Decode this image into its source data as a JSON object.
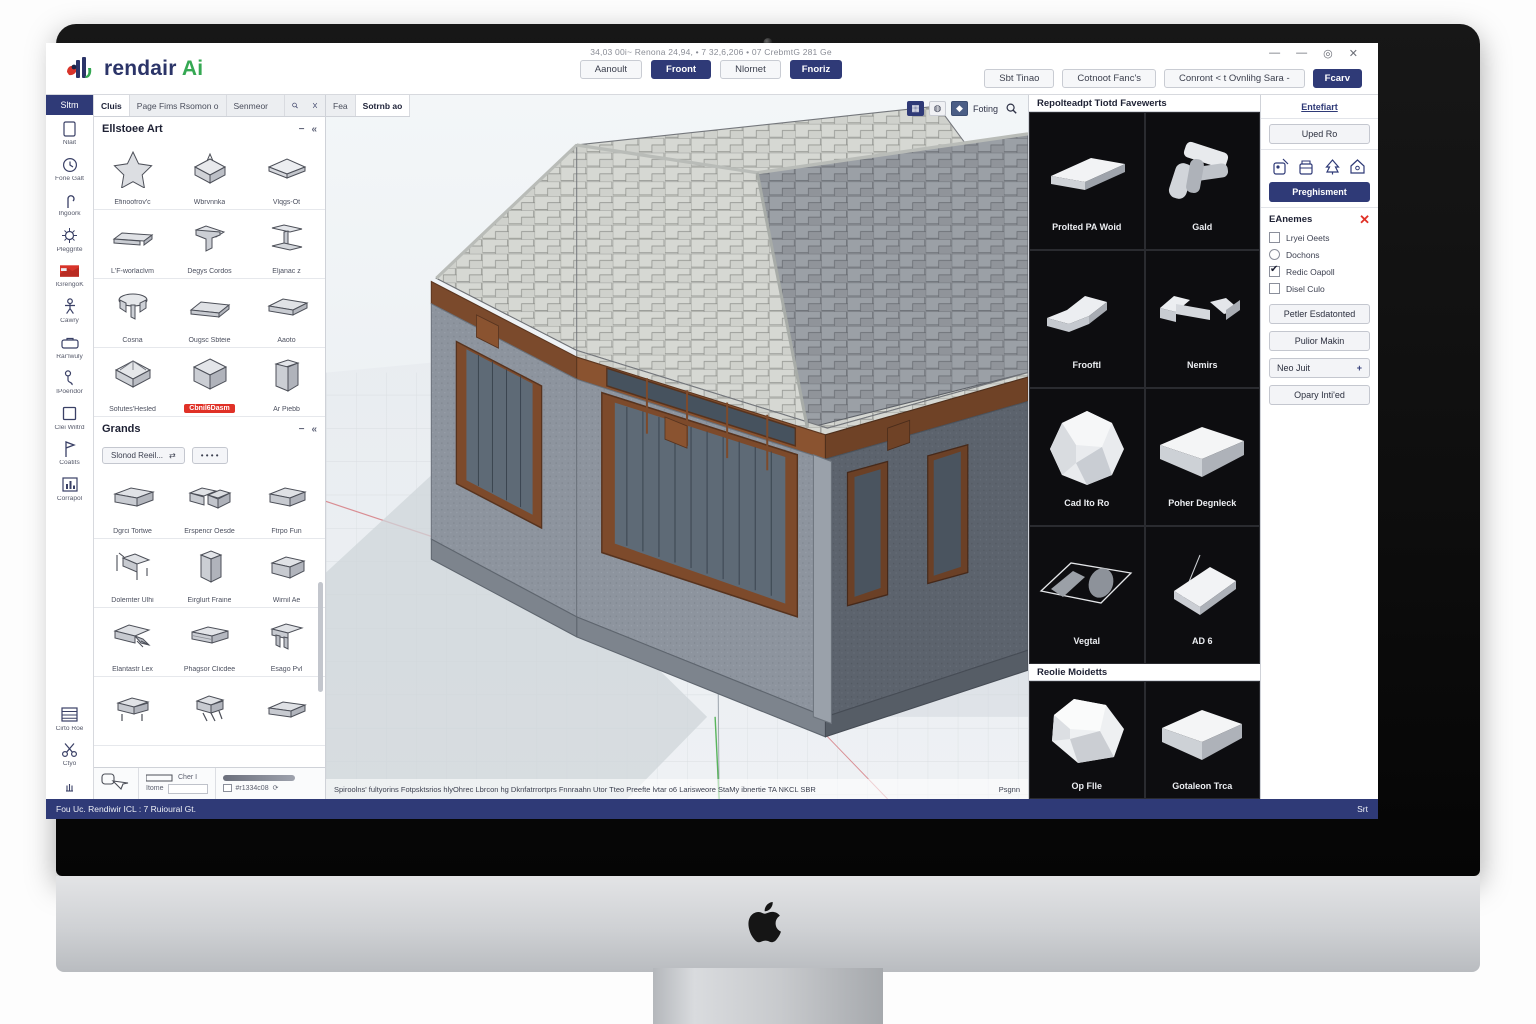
{
  "app": {
    "brand_main": "rendair",
    "brand_suffix": "Ai",
    "title_path": "34,03 00i~  Renona 24,94, • 7 32,6,206  •  07 CrebmtG 281 Ge",
    "status_left": "Fou Uc. Rendiwir ICL : 7 Ruioural Gt.",
    "status_right": "Srt"
  },
  "titlebar": {
    "buttons": [
      {
        "label": "Aanoult",
        "style": "plain"
      },
      {
        "label": "Froont",
        "style": "primary"
      },
      {
        "label": "Nlornet",
        "style": "plain"
      },
      {
        "label": "Fnoriz",
        "style": "primary-sm"
      }
    ],
    "right_buttons": [
      {
        "label": "Sbt Tinao",
        "style": "plain"
      },
      {
        "label": "Cotnoot Fanc's",
        "style": "plain"
      },
      {
        "label": "Conront < t Ovnlihg Sara -",
        "style": "plain"
      },
      {
        "label": "Fcarv",
        "style": "primary"
      }
    ],
    "window_controls": [
      "—",
      "—",
      "◎",
      "✕"
    ]
  },
  "rail": {
    "header": "Sltm",
    "items": [
      {
        "label": "Nlait",
        "icon": "page-icon"
      },
      {
        "label": "Fone Galt",
        "icon": "clock-icon"
      },
      {
        "label": "Ihgoork",
        "icon": "pin-icon"
      },
      {
        "label": "Pleggrite",
        "icon": "node-icon"
      },
      {
        "label": "IGrengoK",
        "icon": "swatch-icon"
      },
      {
        "label": "Cawry",
        "icon": "person-icon"
      },
      {
        "label": "Rar'lwuly",
        "icon": "case-icon"
      },
      {
        "label": "IPoeridor",
        "icon": "figure-icon"
      },
      {
        "label": "Clei Wiltrd",
        "icon": "square-icon"
      },
      {
        "label": "Coatits",
        "icon": "flag-icon"
      },
      {
        "label": "Corrapol",
        "icon": "chart-icon"
      },
      {
        "label": "Cirto Roe",
        "icon": "list-icon"
      },
      {
        "label": "Ctyo",
        "icon": "scissors-icon"
      }
    ],
    "footer_icon": "hand-icon"
  },
  "assets": {
    "tabs": [
      {
        "label": "Cluis",
        "active": true
      },
      {
        "label": "Page Fims Rsomon o",
        "active": false
      },
      {
        "label": "Senmeor",
        "active": false
      }
    ],
    "tab_icons": [
      "search-icon",
      "cut-icon"
    ],
    "vp_tabs": [
      {
        "label": "Fea",
        "active": false
      },
      {
        "label": "Sotrnb ao",
        "active": true
      }
    ],
    "section1": {
      "title": "Ellstoee Art",
      "tools": [
        "−",
        "«"
      ],
      "items": [
        {
          "label": "Efinoofrov'c",
          "shape": "star"
        },
        {
          "label": "Wbrvnnka",
          "shape": "box-peak"
        },
        {
          "label": "Vlqgs-Ot",
          "shape": "slab"
        },
        {
          "label": "L'F-worlaclvm",
          "shape": "beam"
        },
        {
          "label": "Degys Cordos",
          "shape": "bracket"
        },
        {
          "label": "Eljanac z",
          "shape": "i-beam"
        },
        {
          "label": "Cosna",
          "shape": "table"
        },
        {
          "label": "Ougsc Sbteie",
          "shape": "bar"
        },
        {
          "label": "Aaoto",
          "shape": "brick"
        },
        {
          "label": "Sofutes'Hesled",
          "shape": "dome"
        },
        {
          "label": "Cbnil6Dasm",
          "shape": "cube",
          "selected": true
        },
        {
          "label": "Ar Piebb",
          "shape": "panel"
        }
      ]
    },
    "section2": {
      "title": "Grands",
      "tools": [
        "−",
        "«"
      ],
      "chip": "Slonod Reeil...",
      "chip_icon": "shuffle-icon",
      "chip_more": "• • • •",
      "items": [
        {
          "label": "Dgrci Tortwe",
          "shape": "brick"
        },
        {
          "label": "Erspencr Oesde",
          "shape": "twoblock"
        },
        {
          "label": "Ftrpo Fun",
          "shape": "brick"
        },
        {
          "label": "Dolemter Ulhi",
          "shape": "chair"
        },
        {
          "label": "Eirglurt Fraine",
          "shape": "column"
        },
        {
          "label": "Wirnil Ae",
          "shape": "corner"
        },
        {
          "label": "Elantastr Lex",
          "shape": "stair"
        },
        {
          "label": "Phagsor Clicdee",
          "shape": "slab2"
        },
        {
          "label": "Esago Pvl",
          "shape": "frame"
        },
        {
          "label": "",
          "shape": "bench"
        },
        {
          "label": "",
          "shape": "cluster"
        },
        {
          "label": "",
          "shape": "beam2"
        }
      ]
    },
    "footer": {
      "snap_label": "Cher I",
      "dim_label": "Itome",
      "dim_value": "",
      "progress_label": "#r1334c08",
      "progress_icon": "refresh-icon",
      "cursor_icon": "pick-icon"
    }
  },
  "viewport": {
    "toolbar": {
      "icons": [
        "grid-toggle-icon",
        "orbit-icon",
        "render-icon"
      ],
      "label": "Foting",
      "search_icon": "search-icon"
    },
    "status_text": "Spiroolns' fultyorins Fotpsktsrios hlyOhrec Lbrcon hg Dknfatrrortprs Fnnraahn Utor Tteo Preefte lvtar o6 Larisweore StaMy ibnertie TA NKCL SBR",
    "status_right": "Psgnn"
  },
  "modlib": {
    "section1_title": "Repolteadpt Tiotd Favewerts",
    "section1_items": [
      {
        "label": "Prolted PA Woid",
        "shape": "wedge"
      },
      {
        "label": "Gald",
        "shape": "cross"
      },
      {
        "label": "Frooftl",
        "shape": "zigzag"
      },
      {
        "label": "Nemirs",
        "shape": "dumbbell"
      },
      {
        "label": "Cad Ito Ro",
        "shape": "sphere"
      },
      {
        "label": "Poher Degnleck",
        "shape": "plate"
      },
      {
        "label": "Vegtal",
        "shape": "wireframe"
      },
      {
        "label": "AD 6",
        "shape": "card"
      }
    ],
    "section2_title": "Reolie Moidetts",
    "section2_items": [
      {
        "label": "Op Flle",
        "shape": "rock"
      },
      {
        "label": "Gotaleon Trca",
        "shape": "plate"
      }
    ]
  },
  "props": {
    "link": "Entefiart",
    "upload_button": "Uped Ro",
    "icons": [
      "tag-icon",
      "stamp-icon",
      "tree-icon",
      "home-icon"
    ],
    "primary_button": "Preghisment",
    "group_title": "EAnemes",
    "close_icon": "✕",
    "checks": [
      {
        "label": "Lryei Oeets",
        "type": "box",
        "checked": false
      },
      {
        "label": "Dochons",
        "type": "round",
        "checked": false
      },
      {
        "label": "Redic Oapoll",
        "type": "box",
        "checked": true
      },
      {
        "label": "Disel Culo",
        "type": "box",
        "checked": false
      }
    ],
    "buttons": [
      {
        "label": "Petler Esdatonted",
        "plus": false
      },
      {
        "label": "Pulior Makin",
        "plus": false
      },
      {
        "label": "Neo Juit",
        "plus": true
      },
      {
        "label": "Opary Inti'ed",
        "plus": false
      }
    ]
  },
  "colors": {
    "accent": "#2f3a77",
    "alert": "#e03127",
    "green": "#35a853",
    "panel": "#ffffff",
    "dark_panel": "#0d0d10"
  }
}
